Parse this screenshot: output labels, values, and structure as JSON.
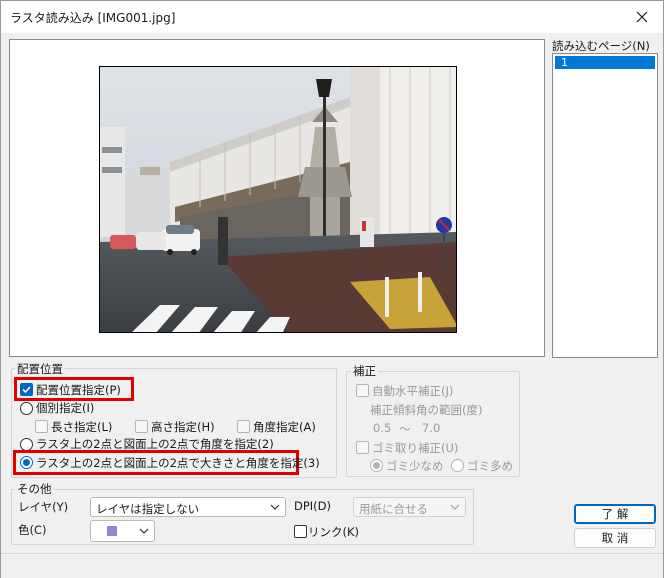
{
  "window": {
    "title": "ラスタ読み込み [IMG001.jpg]"
  },
  "pages": {
    "label": "読み込むページ(N)",
    "items": [
      "1"
    ]
  },
  "placement": {
    "group_label": "配置位置",
    "specify_label": "配置位置指定(P)",
    "specify_checked": true,
    "individual_label": "個別指定(I)",
    "length_label": "長さ指定(L)",
    "height_label": "高さ指定(H)",
    "angle_label": "角度指定(A)",
    "two_point_angle_label": "ラスタ上の2点と図面上の2点で角度を指定(2)",
    "two_point_size_angle_label": "ラスタ上の2点と図面上の2点で大きさと角度を指定(3)",
    "selected_option": "two_point_size_angle"
  },
  "correction": {
    "group_label": "補正",
    "auto_level_label": "自動水平補正(J)",
    "tilt_range_label": "補正傾斜角の範囲(度)",
    "tilt_min": "0.5",
    "tilt_sep": "〜",
    "tilt_max": "7.0",
    "dust_label": "ゴミ取り補正(U)",
    "dust_few_label": "ゴミ少なめ",
    "dust_many_label": "ゴミ多め"
  },
  "other": {
    "group_label": "その他",
    "layer_label": "レイヤ(Y)",
    "layer_value": "レイヤは指定しない",
    "dpi_label": "DPI(D)",
    "dpi_value": "用紙に合せる",
    "color_label": "色(C)",
    "color_swatch": "#8a8ad0",
    "link_label": "リンク(K)"
  },
  "buttons": {
    "ok": "了 解",
    "cancel": "取 消"
  },
  "colors": {
    "highlight": "#e00000",
    "accent": "#0067c0",
    "selection": "#0078d7"
  }
}
